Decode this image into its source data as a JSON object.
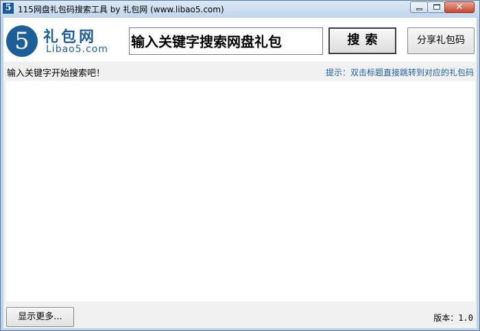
{
  "window": {
    "app_icon_glyph": "5",
    "title": "115网盘礼包码搜索工具 by 礼包网 (www.libao5.com)",
    "close_glyph": "✕"
  },
  "logo": {
    "glyph": "5",
    "name": "礼包网",
    "domain": "Libao5.com",
    "color": "#1d5f99"
  },
  "search": {
    "value": "输入关键字搜索网盘礼包",
    "button_label": "搜索",
    "share_label": "分享礼包码"
  },
  "info": {
    "status": "输入关键字开始搜索吧！",
    "tip": "提示：双击标题直接跳转到对应的礼包码",
    "tip_color": "#1a5fa6"
  },
  "results": [],
  "footer": {
    "more_label": "显示更多...",
    "version_label": "版本：",
    "version_value": "1.0"
  }
}
